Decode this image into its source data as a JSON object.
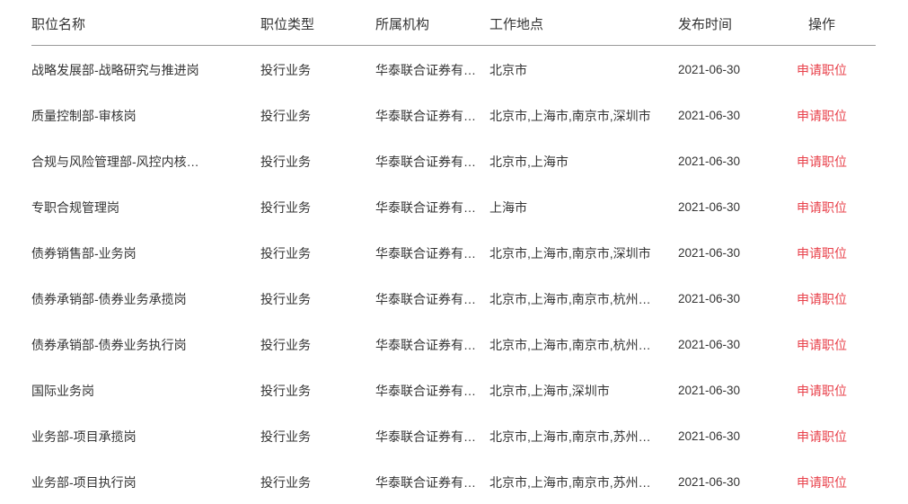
{
  "table": {
    "columns": [
      {
        "key": "title",
        "label": "职位名称"
      },
      {
        "key": "type",
        "label": "职位类型"
      },
      {
        "key": "org",
        "label": "所属机构"
      },
      {
        "key": "loc",
        "label": "工作地点"
      },
      {
        "key": "date",
        "label": "发布时间"
      },
      {
        "key": "action",
        "label": "操作"
      }
    ],
    "action_label": "申请职位",
    "accent_color": "#e8404a",
    "divider_color": "#9a9a9a",
    "rows": [
      {
        "title": "战略发展部-战略研究与推进岗",
        "type": "投行业务",
        "org": "华泰联合证券有…",
        "loc": "北京市",
        "date": "2021-06-30",
        "action": "申请职位"
      },
      {
        "title": "质量控制部-审核岗",
        "type": "投行业务",
        "org": "华泰联合证券有…",
        "loc": "北京市,上海市,南京市,深圳市",
        "date": "2021-06-30",
        "action": "申请职位"
      },
      {
        "title": "合规与风险管理部-风控内核…",
        "type": "投行业务",
        "org": "华泰联合证券有…",
        "loc": "北京市,上海市",
        "date": "2021-06-30",
        "action": "申请职位"
      },
      {
        "title": "专职合规管理岗",
        "type": "投行业务",
        "org": "华泰联合证券有…",
        "loc": "上海市",
        "date": "2021-06-30",
        "action": "申请职位"
      },
      {
        "title": "债券销售部-业务岗",
        "type": "投行业务",
        "org": "华泰联合证券有…",
        "loc": "北京市,上海市,南京市,深圳市",
        "date": "2021-06-30",
        "action": "申请职位"
      },
      {
        "title": "债券承销部-债券业务承揽岗",
        "type": "投行业务",
        "org": "华泰联合证券有…",
        "loc": "北京市,上海市,南京市,杭州…",
        "date": "2021-06-30",
        "action": "申请职位"
      },
      {
        "title": "债券承销部-债券业务执行岗",
        "type": "投行业务",
        "org": "华泰联合证券有…",
        "loc": "北京市,上海市,南京市,杭州…",
        "date": "2021-06-30",
        "action": "申请职位"
      },
      {
        "title": "国际业务岗",
        "type": "投行业务",
        "org": "华泰联合证券有…",
        "loc": "北京市,上海市,深圳市",
        "date": "2021-06-30",
        "action": "申请职位"
      },
      {
        "title": "业务部-项目承揽岗",
        "type": "投行业务",
        "org": "华泰联合证券有…",
        "loc": "北京市,上海市,南京市,苏州…",
        "date": "2021-06-30",
        "action": "申请职位"
      },
      {
        "title": "业务部-项目执行岗",
        "type": "投行业务",
        "org": "华泰联合证券有…",
        "loc": "北京市,上海市,南京市,苏州…",
        "date": "2021-06-30",
        "action": "申请职位"
      }
    ]
  }
}
